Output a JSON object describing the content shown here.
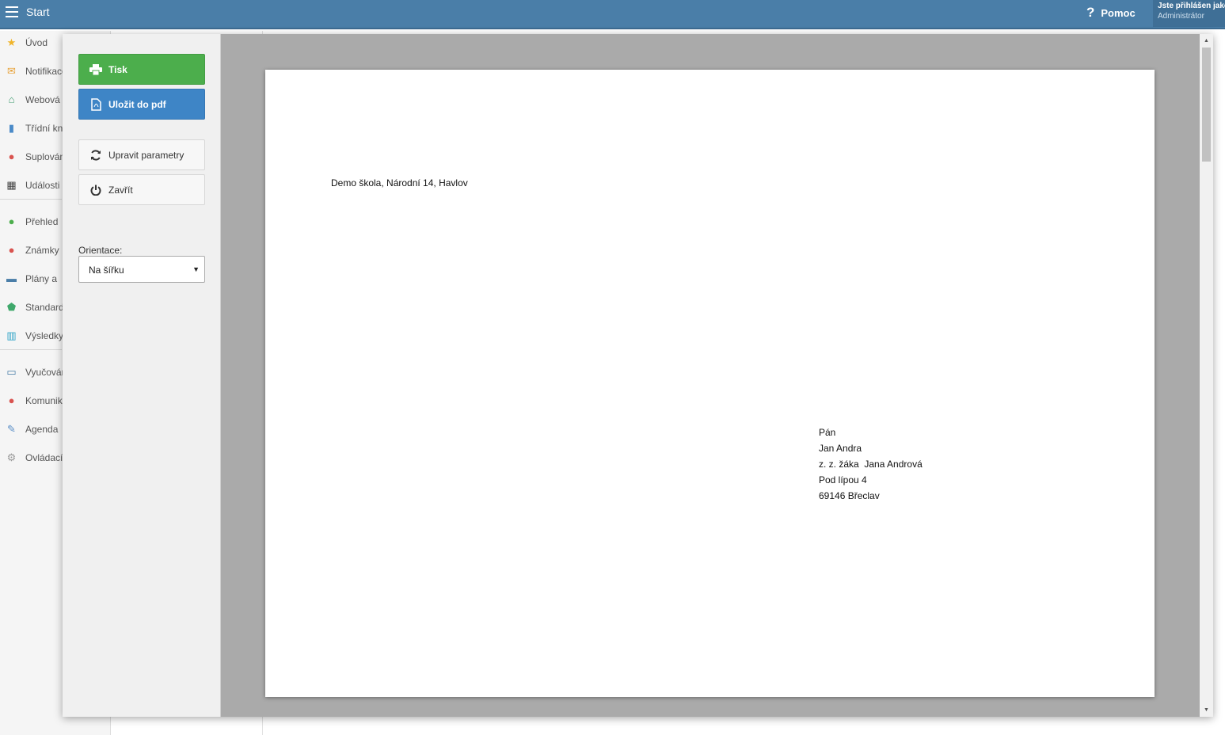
{
  "topbar": {
    "title": "Start",
    "help_label": "Pomoc",
    "user_line1": "Jste přihlášen jako",
    "user_line2": "Administrátor"
  },
  "sidebar": {
    "items": [
      {
        "label": "Úvod",
        "icon": "star-icon",
        "color": "#f0b429"
      },
      {
        "label": "Notifikace",
        "icon": "envelope-icon",
        "color": "#e8a33b"
      },
      {
        "label": "Webová",
        "icon": "home-icon",
        "color": "#3f9c6f"
      },
      {
        "label": "Třídní kniha",
        "icon": "book-icon",
        "color": "#4a8ac8"
      },
      {
        "label": "Suplování",
        "icon": "person-icon",
        "color": "#d9534f"
      },
      {
        "label": "Události",
        "icon": "calendar-icon",
        "color": "#444444"
      },
      {
        "label": "Přehled",
        "icon": "check-circle-icon",
        "color": "#4cae4c"
      },
      {
        "label": "Známky",
        "icon": "grade-icon",
        "color": "#d9534f"
      },
      {
        "label": "Plány a",
        "icon": "briefcase-icon",
        "color": "#4a7ea8"
      },
      {
        "label": "Standardy",
        "icon": "shield-icon",
        "color": "#3fa86b"
      },
      {
        "label": "Výsledky",
        "icon": "bar-chart-icon",
        "color": "#2fa4c7"
      },
      {
        "label": "Vyučování",
        "icon": "open-book-icon",
        "color": "#4a7ea8"
      },
      {
        "label": "Komunikace",
        "icon": "chat-icon",
        "color": "#d9534f"
      },
      {
        "label": "Agenda",
        "icon": "pencil-icon",
        "color": "#5b8fc7"
      },
      {
        "label": "Ovládací",
        "icon": "gear-icon",
        "color": "#999999"
      }
    ]
  },
  "print_panel": {
    "print_label": "Tisk",
    "pdf_label": "Uložit do pdf",
    "edit_params_label": "Upravit parametry",
    "close_label": "Zavřít",
    "orientation_label": "Orientace:",
    "orientation_value": "Na šířku"
  },
  "document": {
    "sender": "Demo škola, Národní 14, Havlov",
    "recipient": {
      "salutation": "Pán",
      "name": "Jan Andra",
      "student": "z. z. žáka  Jana Andrová",
      "street": "Pod lípou 4",
      "city": "69146 Břeclav"
    }
  },
  "colors": {
    "topbar": "#4a7ea8",
    "print_button": "#4cae4c",
    "pdf_button": "#3e85c6",
    "preview_bg": "#aaaaaa"
  }
}
